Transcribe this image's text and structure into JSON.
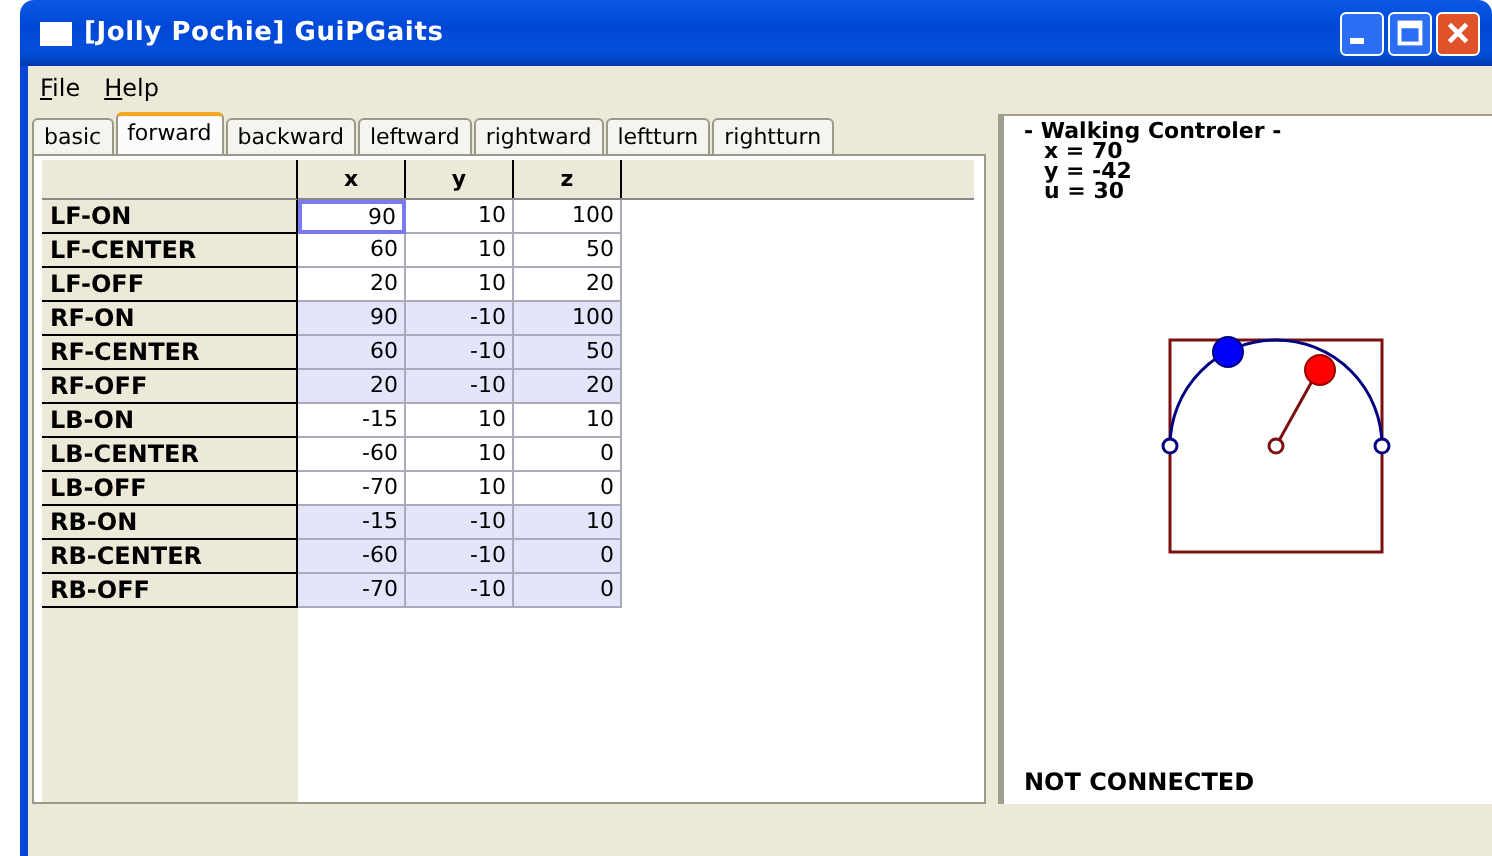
{
  "window": {
    "title": "[Jolly Pochie] GuiPGaits"
  },
  "menu": [
    {
      "label": "File"
    },
    {
      "label": "Help"
    }
  ],
  "tabs": [
    {
      "label": "basic",
      "selected": false
    },
    {
      "label": "forward",
      "selected": true
    },
    {
      "label": "backward",
      "selected": false
    },
    {
      "label": "leftward",
      "selected": false
    },
    {
      "label": "rightward",
      "selected": false
    },
    {
      "label": "leftturn",
      "selected": false
    },
    {
      "label": "rightturn",
      "selected": false
    }
  ],
  "table": {
    "columns": [
      "x",
      "y",
      "z"
    ],
    "rows": [
      {
        "label": "LF-ON",
        "shaded": false,
        "cells": [
          {
            "text": "90",
            "focused": true
          },
          {
            "text": "10",
            "focused": false
          },
          {
            "text": "100",
            "focused": false
          }
        ]
      },
      {
        "label": "LF-CENTER",
        "shaded": false,
        "cells": [
          {
            "text": "60",
            "focused": false
          },
          {
            "text": "10",
            "focused": false
          },
          {
            "text": "50",
            "focused": false
          }
        ]
      },
      {
        "label": "LF-OFF",
        "shaded": false,
        "cells": [
          {
            "text": "20",
            "focused": false
          },
          {
            "text": "10",
            "focused": false
          },
          {
            "text": "20",
            "focused": false
          }
        ]
      },
      {
        "label": "RF-ON",
        "shaded": true,
        "cells": [
          {
            "text": "90",
            "focused": false
          },
          {
            "text": "-10",
            "focused": false
          },
          {
            "text": "100",
            "focused": false
          }
        ]
      },
      {
        "label": "RF-CENTER",
        "shaded": true,
        "cells": [
          {
            "text": "60",
            "focused": false
          },
          {
            "text": "-10",
            "focused": false
          },
          {
            "text": "50",
            "focused": false
          }
        ]
      },
      {
        "label": "RF-OFF",
        "shaded": true,
        "cells": [
          {
            "text": "20",
            "focused": false
          },
          {
            "text": "-10",
            "focused": false
          },
          {
            "text": "20",
            "focused": false
          }
        ]
      },
      {
        "label": "LB-ON",
        "shaded": false,
        "cells": [
          {
            "text": "-15",
            "focused": false
          },
          {
            "text": "10",
            "focused": false
          },
          {
            "text": "10",
            "focused": false
          }
        ]
      },
      {
        "label": "LB-CENTER",
        "shaded": false,
        "cells": [
          {
            "text": "-60",
            "focused": false
          },
          {
            "text": "10",
            "focused": false
          },
          {
            "text": "0",
            "focused": false
          }
        ]
      },
      {
        "label": "LB-OFF",
        "shaded": false,
        "cells": [
          {
            "text": "-70",
            "focused": false
          },
          {
            "text": "10",
            "focused": false
          },
          {
            "text": "0",
            "focused": false
          }
        ]
      },
      {
        "label": "RB-ON",
        "shaded": true,
        "cells": [
          {
            "text": "-15",
            "focused": false
          },
          {
            "text": "-10",
            "focused": false
          },
          {
            "text": "10",
            "focused": false
          }
        ]
      },
      {
        "label": "RB-CENTER",
        "shaded": true,
        "cells": [
          {
            "text": "-60",
            "focused": false
          },
          {
            "text": "-10",
            "focused": false
          },
          {
            "text": "0",
            "focused": false
          }
        ]
      },
      {
        "label": "RB-OFF",
        "shaded": true,
        "cells": [
          {
            "text": "-70",
            "focused": false
          },
          {
            "text": "-10",
            "focused": false
          },
          {
            "text": "0",
            "focused": false
          }
        ]
      }
    ]
  },
  "controller": {
    "title": "- Walking Controler -",
    "readings": [
      "x = 70",
      "y = -42",
      "u = 30"
    ],
    "status": "NOT CONNECTED"
  }
}
